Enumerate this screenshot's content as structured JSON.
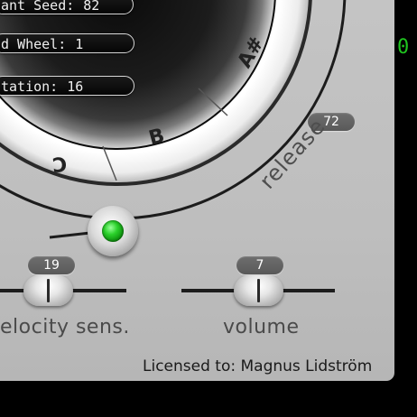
{
  "readouts": [
    {
      "label": "ant Seed:",
      "value": "82"
    },
    {
      "label": "d Wheel:",
      "value": "1"
    },
    {
      "label": "tation:",
      "value": "16"
    }
  ],
  "wheel": {
    "notes": [
      "A#",
      "B",
      "C"
    ]
  },
  "release": {
    "label": "release",
    "value": "72"
  },
  "velocity": {
    "label": "elocity sens.",
    "value": "19"
  },
  "volume": {
    "label": "volume",
    "value": "7"
  },
  "license": "Licensed to: Magnus Lidström",
  "side_text": "0",
  "colors": {
    "panel": "#c0c0c0",
    "led": "#2bd12b",
    "side_text": "#1fc41f",
    "badge": "#636363"
  }
}
